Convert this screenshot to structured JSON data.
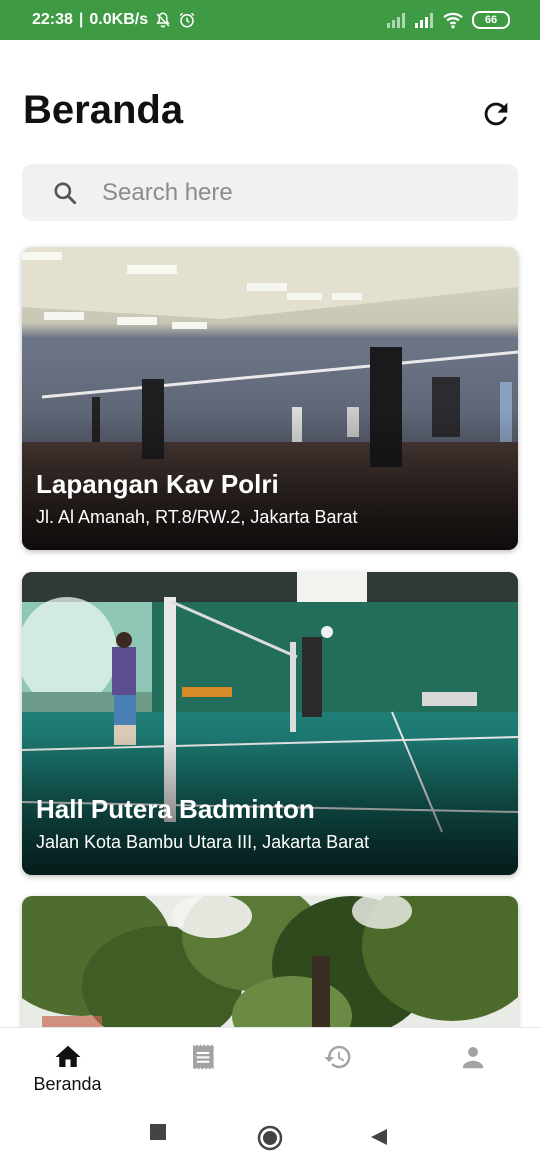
{
  "status_bar": {
    "time": "22:38",
    "network_speed": "0.0KB/s",
    "battery": "66",
    "icons": [
      "notifications-off-icon",
      "alarm-icon",
      "signal-icon",
      "signal-icon",
      "wifi-icon",
      "battery-icon"
    ],
    "background_color": "#3e9a43"
  },
  "header": {
    "title": "Beranda",
    "refresh_icon": "refresh-icon"
  },
  "search": {
    "placeholder": "Search here",
    "value": "",
    "icon": "search-icon"
  },
  "venues": [
    {
      "name": "Lapangan Kav Polri",
      "address": "Jl. Al Amanah, RT.8/RW.2, Jakarta Barat"
    },
    {
      "name": "Hall Putera Badminton",
      "address": "Jalan Kota Bambu Utara III, Jakarta Barat"
    },
    {
      "name": "",
      "address": ""
    }
  ],
  "bottom_nav": {
    "items": [
      {
        "label": "Beranda",
        "icon": "home-icon",
        "active": true
      },
      {
        "label": "",
        "icon": "receipt-icon",
        "active": false
      },
      {
        "label": "",
        "icon": "history-icon",
        "active": false
      },
      {
        "label": "",
        "icon": "person-icon",
        "active": false
      }
    ],
    "active_color": "#111111",
    "inactive_color": "#9e9e9e"
  },
  "system_nav": {
    "icons": [
      "recents-square-icon",
      "home-circle-icon",
      "back-triangle-icon"
    ]
  }
}
